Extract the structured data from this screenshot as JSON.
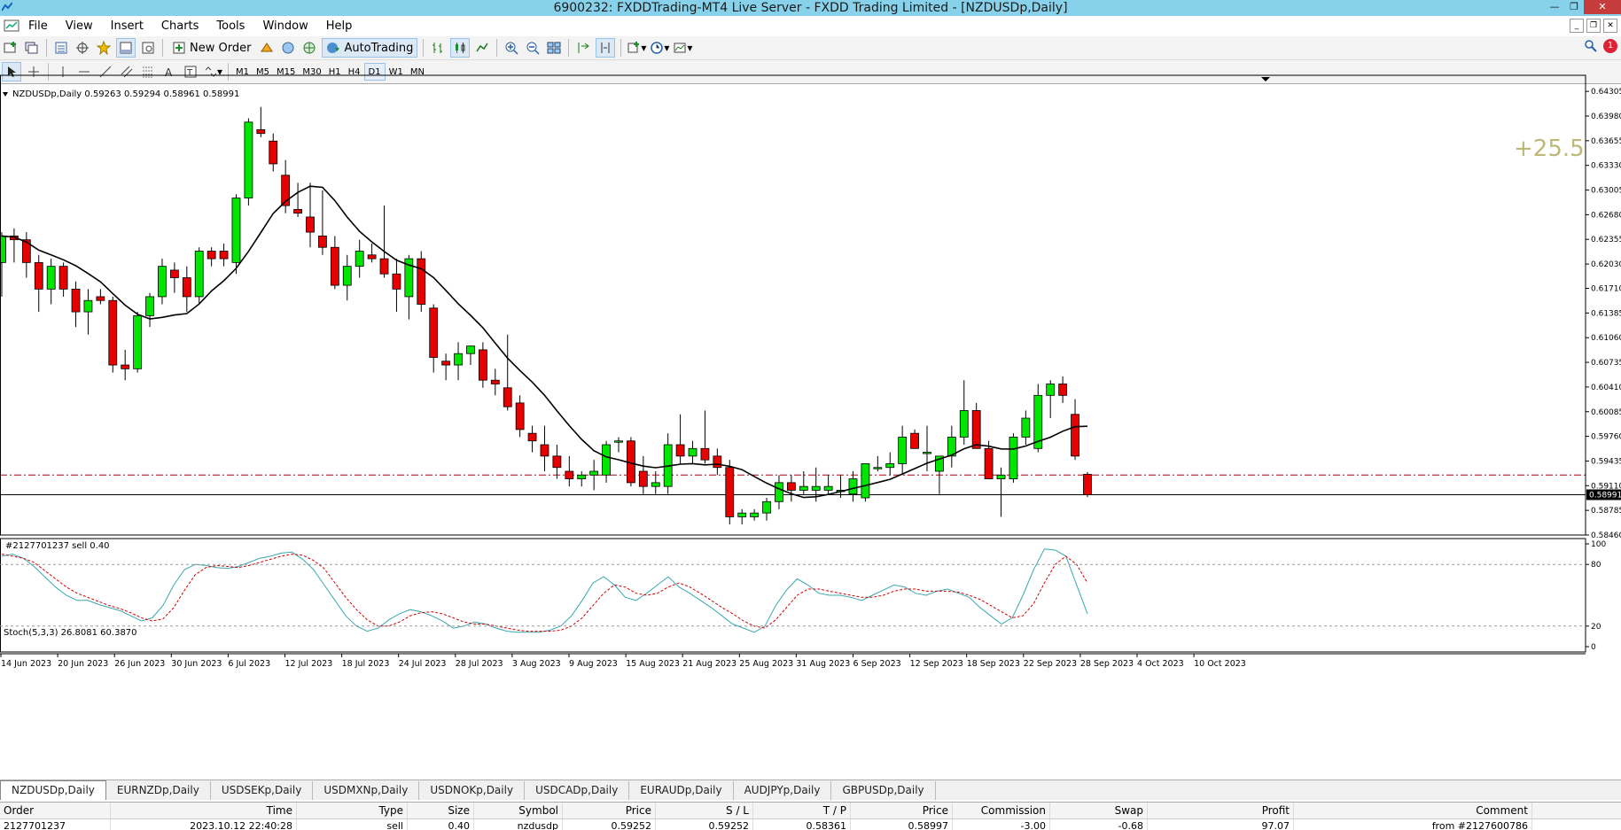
{
  "window": {
    "title": "6900232: FXDDTrading-MT4 Live Server - FXDD Trading Limited - [NZDUSDp,Daily]"
  },
  "menu": [
    "File",
    "View",
    "Insert",
    "Charts",
    "Tools",
    "Window",
    "Help"
  ],
  "toolbar": {
    "new_order_label": "New Order",
    "autotrading_label": "AutoTrading",
    "notification_count": "1",
    "timeframes": [
      "M1",
      "M5",
      "M15",
      "M30",
      "H1",
      "H4",
      "D1",
      "W1",
      "MN"
    ],
    "active_timeframe": "D1"
  },
  "chart": {
    "info": "NZDUSDp,Daily  0.59263 0.59294 0.58961 0.58991",
    "profit_overlay": "+25.5",
    "order_line_label": "#2127701237 sell 0.40",
    "bid_price_label": "0.58991",
    "stoch_label": "Stoch(5,3,3) 26.8081 60.3870",
    "colors": {
      "bull": "#00e600",
      "bear": "#e60000",
      "ma": "#000000",
      "stoch_main": "#3aa7b0",
      "stoch_signal": "#d00000",
      "overlay": "#bcb878"
    }
  },
  "chart_data": {
    "type": "candlestick",
    "symbol": "NZDUSDp",
    "timeframe": "Daily",
    "price_axis_ticks": [
      "0.64305",
      "0.63980",
      "0.63655",
      "0.63330",
      "0.63005",
      "0.62680",
      "0.62355",
      "0.62030",
      "0.61710",
      "0.61385",
      "0.61060",
      "0.60735",
      "0.60410",
      "0.60085",
      "0.59760",
      "0.59435",
      "0.59110",
      "0.58991",
      "0.58785",
      "0.58460"
    ],
    "ylim": [
      0.5846,
      0.6447
    ],
    "stoch_axis_ticks": [
      "100",
      "80",
      "20",
      "0"
    ],
    "date_labels": [
      "14 Jun 2023",
      "20 Jun 2023",
      "26 Jun 2023",
      "30 Jun 2023",
      "6 Jul 2023",
      "12 Jul 2023",
      "18 Jul 2023",
      "24 Jul 2023",
      "28 Jul 2023",
      "3 Aug 2023",
      "9 Aug 2023",
      "15 Aug 2023",
      "21 Aug 2023",
      "25 Aug 2023",
      "31 Aug 2023",
      "6 Sep 2023",
      "12 Sep 2023",
      "18 Sep 2023",
      "22 Sep 2023",
      "28 Sep 2023",
      "4 Oct 2023",
      "10 Oct 2023"
    ],
    "order_price": 0.5925,
    "last_price": 0.58991,
    "candles": [
      [
        0.6205,
        0.6245,
        0.616,
        0.624
      ],
      [
        0.624,
        0.625,
        0.6205,
        0.6235
      ],
      [
        0.6235,
        0.6245,
        0.6185,
        0.6205
      ],
      [
        0.6205,
        0.6215,
        0.614,
        0.617
      ],
      [
        0.617,
        0.621,
        0.615,
        0.62
      ],
      [
        0.62,
        0.6205,
        0.616,
        0.617
      ],
      [
        0.617,
        0.618,
        0.612,
        0.614
      ],
      [
        0.614,
        0.617,
        0.611,
        0.6155
      ],
      [
        0.616,
        0.617,
        0.615,
        0.6155
      ],
      [
        0.6155,
        0.616,
        0.606,
        0.607
      ],
      [
        0.607,
        0.609,
        0.605,
        0.6065
      ],
      [
        0.6065,
        0.614,
        0.606,
        0.6135
      ],
      [
        0.6135,
        0.6165,
        0.612,
        0.616
      ],
      [
        0.616,
        0.621,
        0.615,
        0.62
      ],
      [
        0.6195,
        0.6205,
        0.6165,
        0.6185
      ],
      [
        0.6185,
        0.62,
        0.614,
        0.616
      ],
      [
        0.616,
        0.6225,
        0.615,
        0.622
      ],
      [
        0.622,
        0.6225,
        0.62,
        0.621
      ],
      [
        0.622,
        0.623,
        0.62,
        0.621
      ],
      [
        0.6205,
        0.6295,
        0.619,
        0.629
      ],
      [
        0.629,
        0.6395,
        0.628,
        0.639
      ],
      [
        0.638,
        0.641,
        0.637,
        0.6375
      ],
      [
        0.6365,
        0.6375,
        0.6325,
        0.6335
      ],
      [
        0.632,
        0.634,
        0.627,
        0.628
      ],
      [
        0.6275,
        0.631,
        0.6265,
        0.627
      ],
      [
        0.6265,
        0.631,
        0.6225,
        0.6245
      ],
      [
        0.624,
        0.63,
        0.6215,
        0.6225
      ],
      [
        0.6225,
        0.624,
        0.617,
        0.6175
      ],
      [
        0.6175,
        0.6215,
        0.6155,
        0.62
      ],
      [
        0.62,
        0.6235,
        0.6185,
        0.622
      ],
      [
        0.6215,
        0.623,
        0.6205,
        0.621
      ],
      [
        0.621,
        0.628,
        0.6185,
        0.619
      ],
      [
        0.619,
        0.621,
        0.614,
        0.617
      ],
      [
        0.616,
        0.6215,
        0.613,
        0.621
      ],
      [
        0.621,
        0.622,
        0.614,
        0.615
      ],
      [
        0.6145,
        0.615,
        0.606,
        0.608
      ],
      [
        0.6075,
        0.6085,
        0.605,
        0.607
      ],
      [
        0.607,
        0.61,
        0.605,
        0.6085
      ],
      [
        0.6085,
        0.6095,
        0.607,
        0.6095
      ],
      [
        0.609,
        0.61,
        0.604,
        0.605
      ],
      [
        0.605,
        0.6065,
        0.603,
        0.6045
      ],
      [
        0.604,
        0.611,
        0.601,
        0.6015
      ],
      [
        0.602,
        0.603,
        0.5975,
        0.5985
      ],
      [
        0.598,
        0.599,
        0.5955,
        0.597
      ],
      [
        0.5965,
        0.599,
        0.593,
        0.595
      ],
      [
        0.595,
        0.5965,
        0.592,
        0.5935
      ],
      [
        0.593,
        0.595,
        0.591,
        0.592
      ],
      [
        0.592,
        0.593,
        0.591,
        0.5925
      ],
      [
        0.5925,
        0.5945,
        0.5905,
        0.593
      ],
      [
        0.5925,
        0.597,
        0.5915,
        0.5965
      ],
      [
        0.597,
        0.5975,
        0.5955,
        0.597
      ],
      [
        0.597,
        0.5975,
        0.591,
        0.5915
      ],
      [
        0.593,
        0.595,
        0.59,
        0.591
      ],
      [
        0.591,
        0.593,
        0.59,
        0.5915
      ],
      [
        0.591,
        0.598,
        0.59,
        0.5965
      ],
      [
        0.5965,
        0.6005,
        0.594,
        0.595
      ],
      [
        0.595,
        0.597,
        0.594,
        0.596
      ],
      [
        0.596,
        0.601,
        0.594,
        0.5945
      ],
      [
        0.595,
        0.596,
        0.5925,
        0.5935
      ],
      [
        0.5935,
        0.5945,
        0.586,
        0.587
      ],
      [
        0.587,
        0.588,
        0.586,
        0.5875
      ],
      [
        0.587,
        0.588,
        0.5865,
        0.5875
      ],
      [
        0.5875,
        0.5895,
        0.5865,
        0.589
      ],
      [
        0.589,
        0.5925,
        0.588,
        0.5915
      ],
      [
        0.5915,
        0.5925,
        0.589,
        0.5905
      ],
      [
        0.5905,
        0.593,
        0.59,
        0.591
      ],
      [
        0.5905,
        0.5935,
        0.589,
        0.591
      ],
      [
        0.5905,
        0.5925,
        0.59,
        0.591
      ],
      [
        0.5905,
        0.5925,
        0.5895,
        0.5905
      ],
      [
        0.59,
        0.593,
        0.589,
        0.592
      ],
      [
        0.5895,
        0.594,
        0.589,
        0.594
      ],
      [
        0.5935,
        0.595,
        0.593,
        0.5935
      ],
      [
        0.5935,
        0.5955,
        0.5925,
        0.594
      ],
      [
        0.594,
        0.599,
        0.5925,
        0.5975
      ],
      [
        0.598,
        0.5985,
        0.596,
        0.596
      ],
      [
        0.5955,
        0.599,
        0.593,
        0.5955
      ],
      [
        0.593,
        0.5945,
        0.59,
        0.595
      ],
      [
        0.595,
        0.599,
        0.5935,
        0.5975
      ],
      [
        0.5975,
        0.605,
        0.5965,
        0.601
      ],
      [
        0.601,
        0.602,
        0.597,
        0.596
      ],
      [
        0.596,
        0.597,
        0.592,
        0.592
      ],
      [
        0.592,
        0.5935,
        0.587,
        0.5925
      ],
      [
        0.592,
        0.598,
        0.5915,
        0.5975
      ],
      [
        0.5975,
        0.601,
        0.5965,
        0.6
      ],
      [
        0.596,
        0.6045,
        0.5955,
        0.603
      ],
      [
        0.603,
        0.605,
        0.6,
        0.6045
      ],
      [
        0.6045,
        0.6055,
        0.602,
        0.603
      ],
      [
        0.6005,
        0.6025,
        0.5945,
        0.595
      ],
      [
        0.5926,
        0.5929,
        0.5896,
        0.5899
      ]
    ],
    "ma_note": "smoothed moving average line",
    "stoch_main": [
      88,
      90,
      86,
      78,
      68,
      58,
      50,
      45,
      45,
      41,
      38,
      35,
      30,
      25,
      28,
      40,
      60,
      75,
      80,
      79,
      77,
      76,
      78,
      82,
      86,
      88,
      91,
      92,
      85,
      75,
      60,
      45,
      30,
      20,
      15,
      18,
      26,
      32,
      36,
      34,
      30,
      25,
      18,
      20,
      24,
      22,
      18,
      15,
      14,
      14,
      14,
      16,
      20,
      30,
      45,
      62,
      68,
      60,
      48,
      45,
      52,
      60,
      68,
      58,
      52,
      45,
      38,
      30,
      22,
      18,
      14,
      20,
      40,
      55,
      66,
      60,
      52,
      50,
      50,
      48,
      45,
      50,
      55,
      60,
      58,
      52,
      50,
      54,
      56,
      52,
      48,
      38,
      30,
      22,
      28,
      50,
      75,
      95,
      94,
      88,
      60,
      32
    ],
    "stoch_signal": [
      90,
      88,
      86,
      82,
      74,
      66,
      58,
      52,
      48,
      44,
      40,
      37,
      33,
      28,
      25,
      27,
      38,
      55,
      70,
      77,
      79,
      78,
      77,
      79,
      82,
      85,
      88,
      90,
      89,
      84,
      76,
      62,
      48,
      36,
      26,
      20,
      20,
      24,
      30,
      33,
      34,
      32,
      28,
      24,
      22,
      22,
      20,
      18,
      16,
      15,
      15,
      15,
      16,
      20,
      28,
      40,
      52,
      60,
      58,
      52,
      50,
      52,
      58,
      62,
      58,
      52,
      45,
      38,
      32,
      25,
      20,
      18,
      26,
      38,
      50,
      56,
      56,
      54,
      52,
      50,
      48,
      48,
      50,
      54,
      56,
      56,
      54,
      54,
      54,
      53,
      50,
      46,
      40,
      34,
      28,
      30,
      42,
      62,
      80,
      88,
      80,
      62
    ]
  },
  "tabs": {
    "items": [
      "NZDUSDp,Daily",
      "EURNZDp,Daily",
      "USDSEKp,Daily",
      "USDMXNp,Daily",
      "USDNOKp,Daily",
      "USDCADp,Daily",
      "EURAUDp,Daily",
      "AUDJPYp,Daily",
      "GBPUSDp,Daily"
    ],
    "active": 0
  },
  "terminal": {
    "columns": [
      "Order",
      "Time",
      "Type",
      "Size",
      "Symbol",
      "Price",
      "S / L",
      "T / P",
      "Price",
      "Commission",
      "Swap",
      "Profit",
      "Comment"
    ],
    "rows": [
      [
        "2127701237",
        "2023.10.12 22:40:28",
        "sell",
        "0.40",
        "nzdusdp",
        "0.59252",
        "0.59252",
        "0.58361",
        "0.58997",
        "-3.00",
        "-0.68",
        "97.07",
        "from #2127600786"
      ]
    ]
  }
}
